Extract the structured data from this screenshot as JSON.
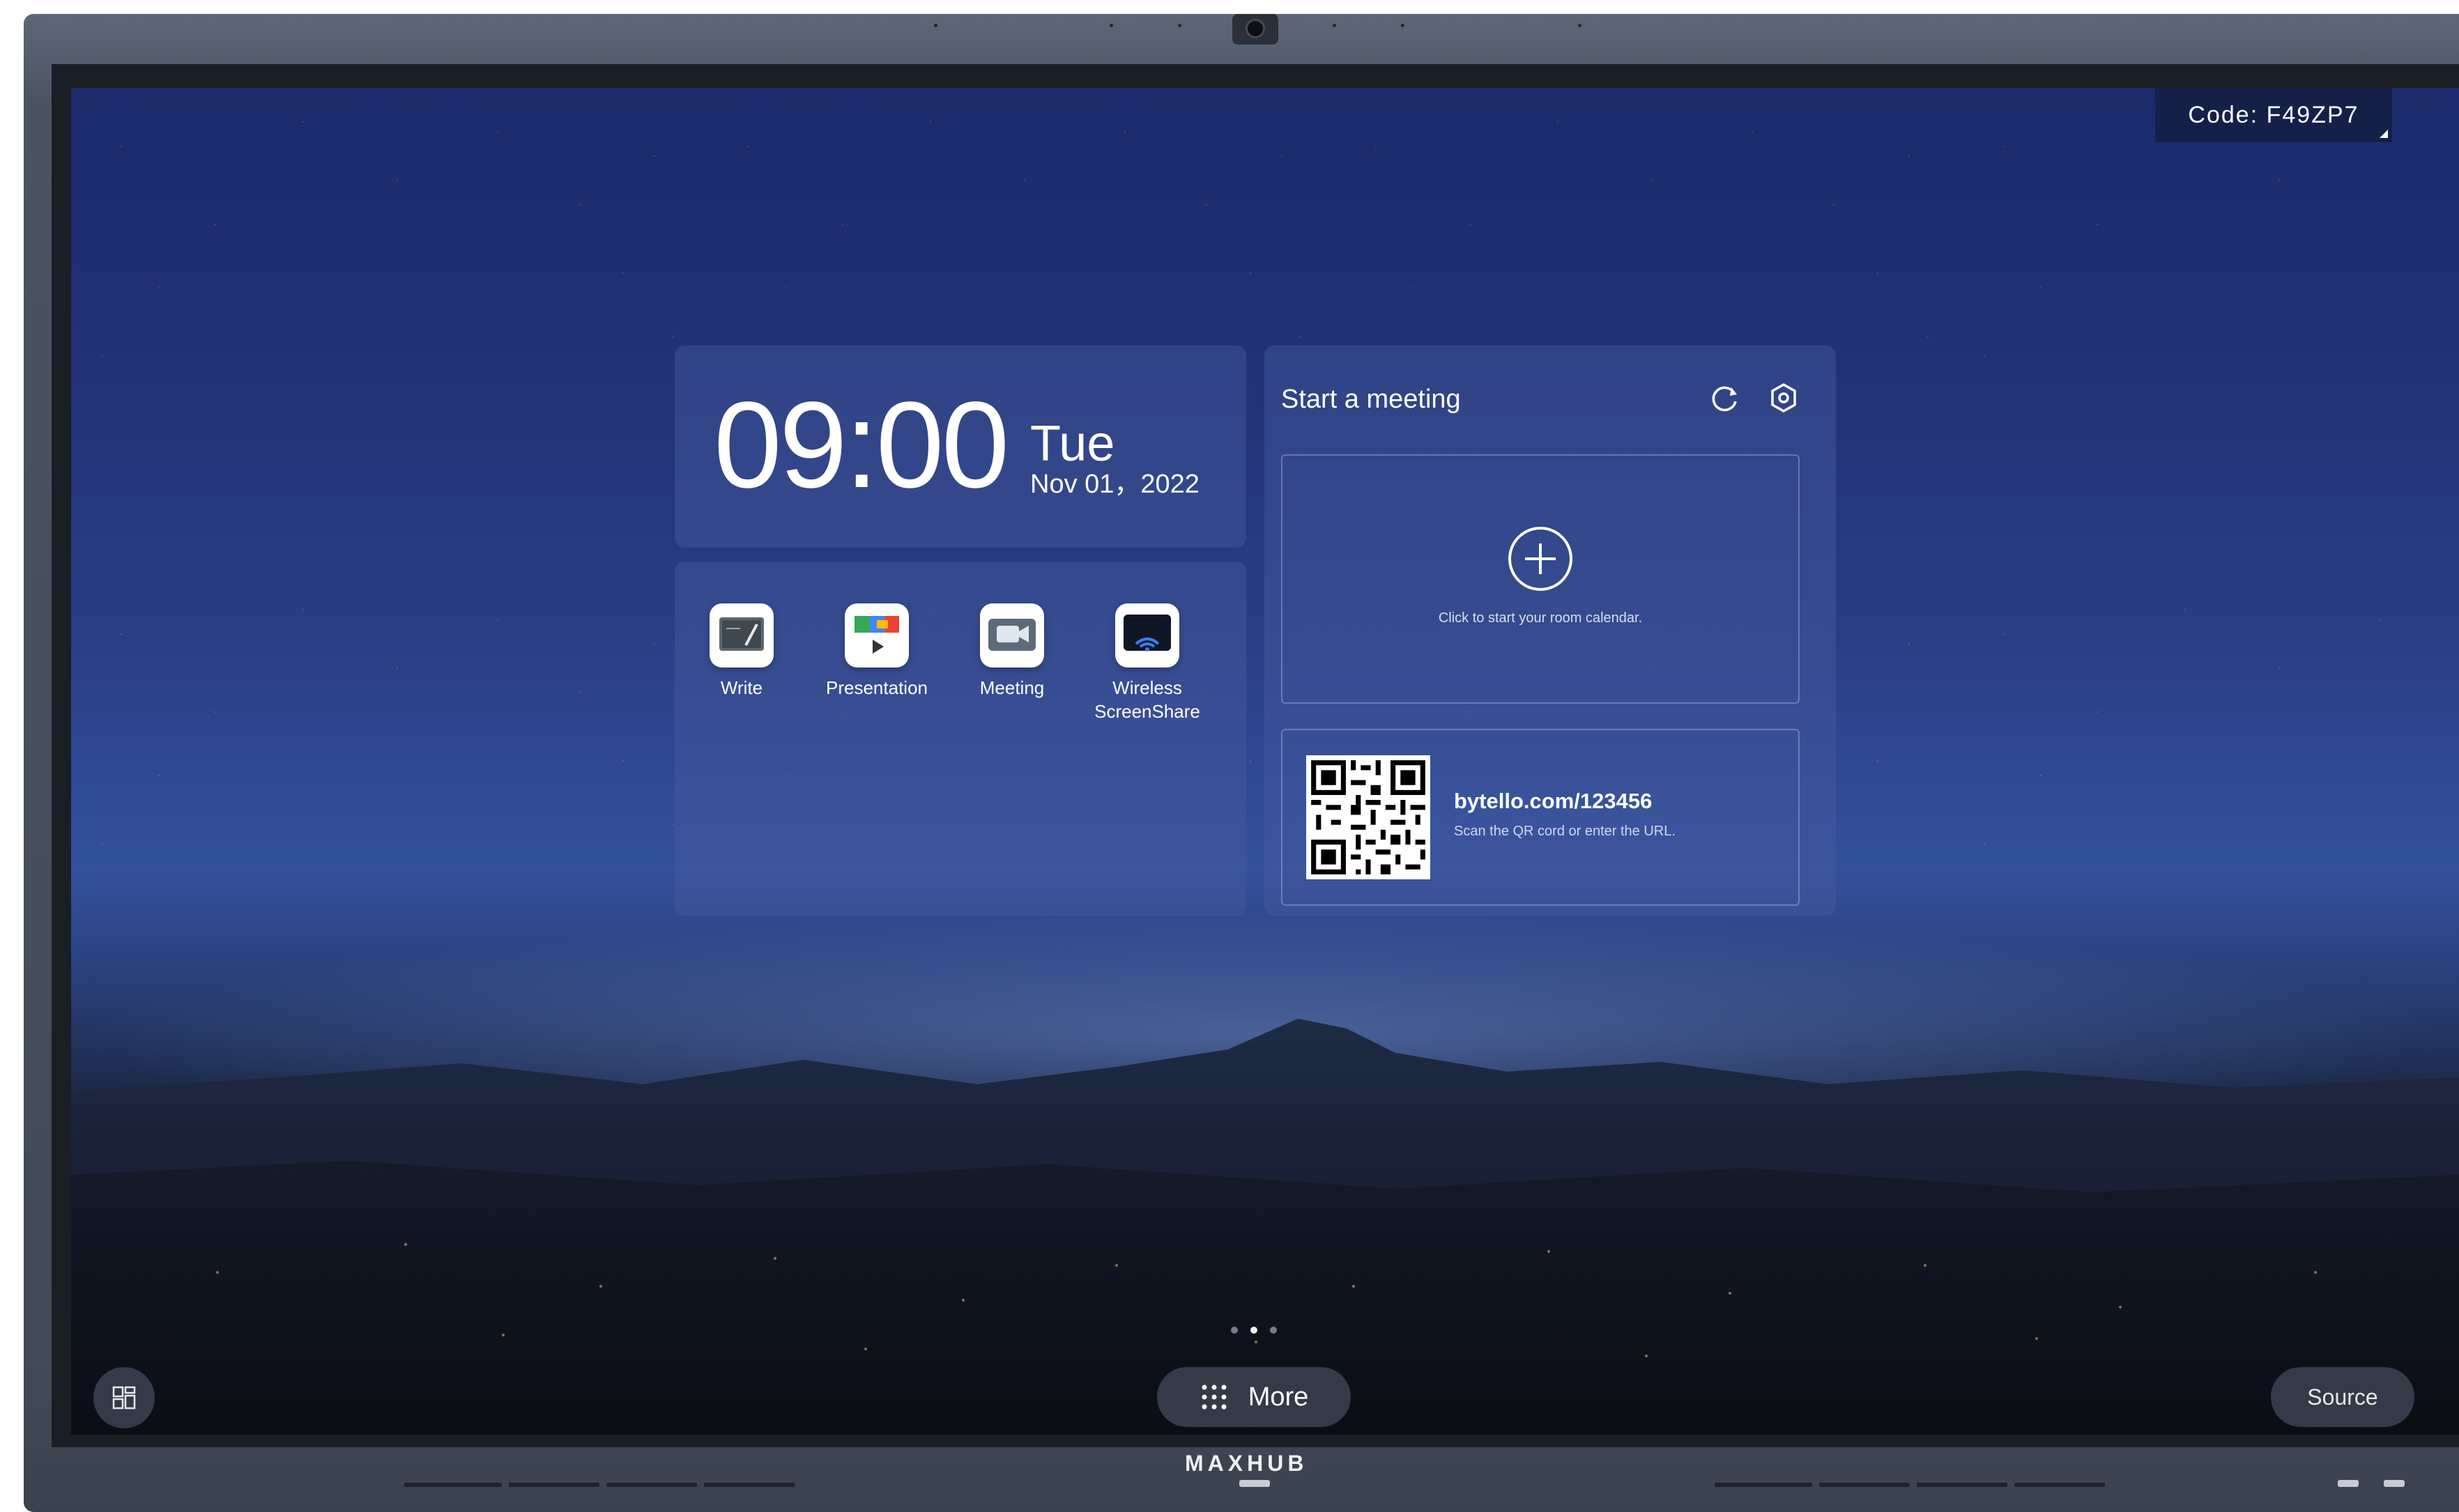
{
  "device": {
    "brand": "MAXHUB"
  },
  "screen": {
    "code_badge": {
      "label": "Code:",
      "value": "F49ZP7"
    },
    "clock": {
      "time": "09:00",
      "day": "Tue",
      "date": "Nov 01，2022"
    },
    "apps": [
      {
        "label": "Write",
        "icon": "whiteboard-icon"
      },
      {
        "label": "Presentation",
        "icon": "presentation-icon"
      },
      {
        "label": "Meeting",
        "icon": "video-meeting-icon"
      },
      {
        "label": "Wireless\nScreenShare",
        "icon": "wireless-screenshare-icon"
      }
    ],
    "meeting": {
      "title": "Start a meeting",
      "refresh_icon": "refresh-icon",
      "settings_icon": "settings-icon",
      "calendar_hint": "Click to start your room calendar.",
      "qr_url": "bytello.com/123456",
      "qr_hint": "Scan the QR cord or enter the URL."
    },
    "pager": {
      "total": 3,
      "active": 1
    },
    "bottom_bar": {
      "more_label": "More",
      "more_icon": "apps-grid-icon",
      "left_icon": "widgets-icon",
      "source_label": "Source"
    }
  },
  "colors": {
    "panel": "#4a5ea0",
    "sky_top": "#1b2a6a",
    "sky_horizon": "#33519c"
  }
}
